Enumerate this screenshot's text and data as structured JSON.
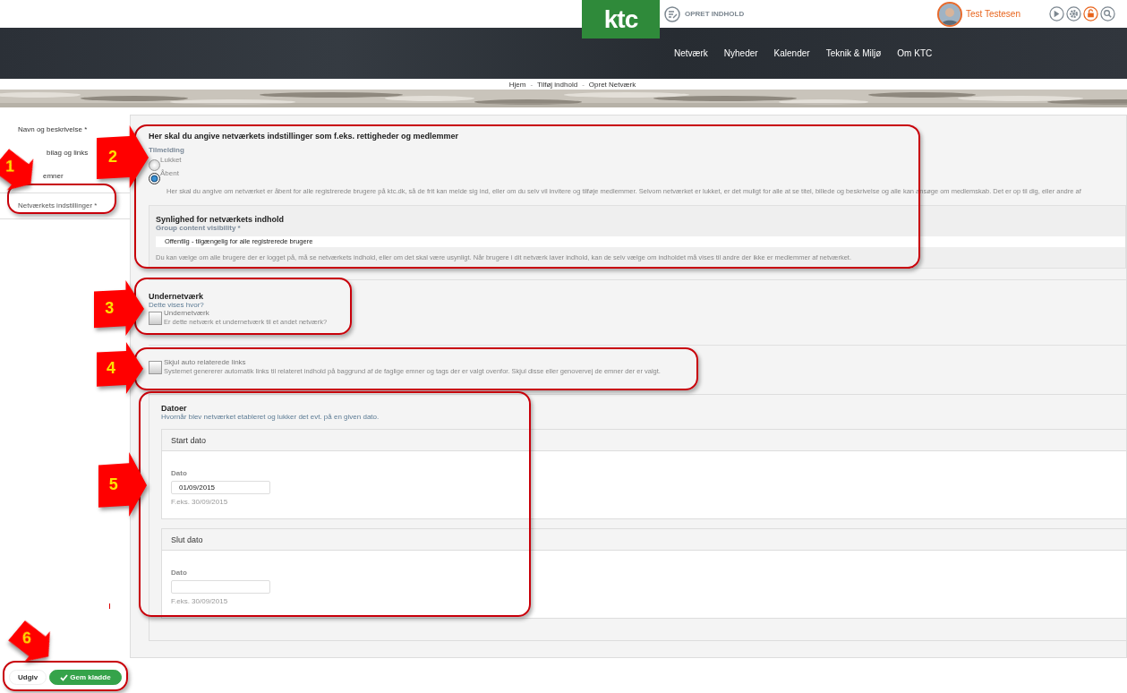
{
  "header": {
    "logo": "ktc",
    "create_label": "OPRET INDHOLD",
    "user_name": "Test Testesen"
  },
  "nav": [
    {
      "label": "Netværk"
    },
    {
      "label": "Nyheder"
    },
    {
      "label": "Kalender"
    },
    {
      "label": "Teknik & Miljø"
    },
    {
      "label": "Om KTC"
    }
  ],
  "breadcrumb": {
    "items": [
      "Hjem",
      "Tilføj indhold",
      "Opret Netværk"
    ],
    "separator": "-"
  },
  "sidebar": {
    "items": [
      {
        "label": "Navn og beskrivelse *",
        "selected": false
      },
      {
        "label": "bilag og links",
        "selected": false
      },
      {
        "label": "emner",
        "selected": false
      },
      {
        "label": "Netværkets indstillinger *",
        "selected": true
      }
    ]
  },
  "settings": {
    "heading": "Her skal du angive netværkets indstillinger som f.eks. rettigheder og medlemmer",
    "membership": {
      "label": "Tilmelding",
      "options": [
        {
          "label": "Lukket",
          "selected": false
        },
        {
          "label": "Åbent",
          "selected": true
        }
      ],
      "help": "Her skal du angive om netværket er åbent for alle registrerede brugere på ktc.dk, så de frit kan melde sig ind, eller om du selv vil invitere og tilføje medlemmer. Selvom netværket er lukket, er det muligt for alle at se titel, billede og beskrivelse og alle kan ansøge om medlemskab. Det er op til dig, eller andre af"
    },
    "visibility": {
      "title": "Synlighed for netværkets indhold",
      "label": "Group content visibility *",
      "value": "Offentlig - tilgængelig for alle registrerede brugere",
      "help": "Du kan vælge om alle brugere der er logget på, må se netværkets indhold, eller om det skal være usynligt. Når brugere i dit netværk laver indhold, kan de selv vælge om indholdet må vises til andre der ikke er medlemmer af netværket."
    }
  },
  "subnetwork": {
    "title": "Undernetværk",
    "subtitle": "Dette vises hvor?",
    "checkbox": {
      "label": "Undernetværk",
      "checked": false
    },
    "help": "Er dette netværk et undernetværk til et andet netværk?"
  },
  "related_links": {
    "checkbox": {
      "label": "Skjul auto relaterede links",
      "checked": false
    },
    "help": "Systemet genererer automatik links til relateret indhold på baggrund af de faglige emner og tags der er valgt ovenfor. Skjul disse eller genovervej de emner der er valgt."
  },
  "dates": {
    "title": "Datoer",
    "subtitle": "Hvornår blev netværket etableret og lukker det evt. på en given dato.",
    "fieldsets": [
      {
        "legend": "Start dato",
        "label": "Dato",
        "value": "01/09/2015",
        "hint": "F.eks. 30/09/2015"
      },
      {
        "legend": "Slut dato",
        "label": "Dato",
        "hint": "F.eks. 30/09/2015"
      }
    ]
  },
  "actions": [
    {
      "label": "Udgiv",
      "kind": "plain"
    },
    {
      "label": "Gem kladde",
      "kind": "primary"
    }
  ],
  "callouts": [
    {
      "number": "1"
    },
    {
      "number": "2"
    },
    {
      "number": "3"
    },
    {
      "number": "4"
    },
    {
      "number": "5"
    },
    {
      "number": "6"
    }
  ]
}
